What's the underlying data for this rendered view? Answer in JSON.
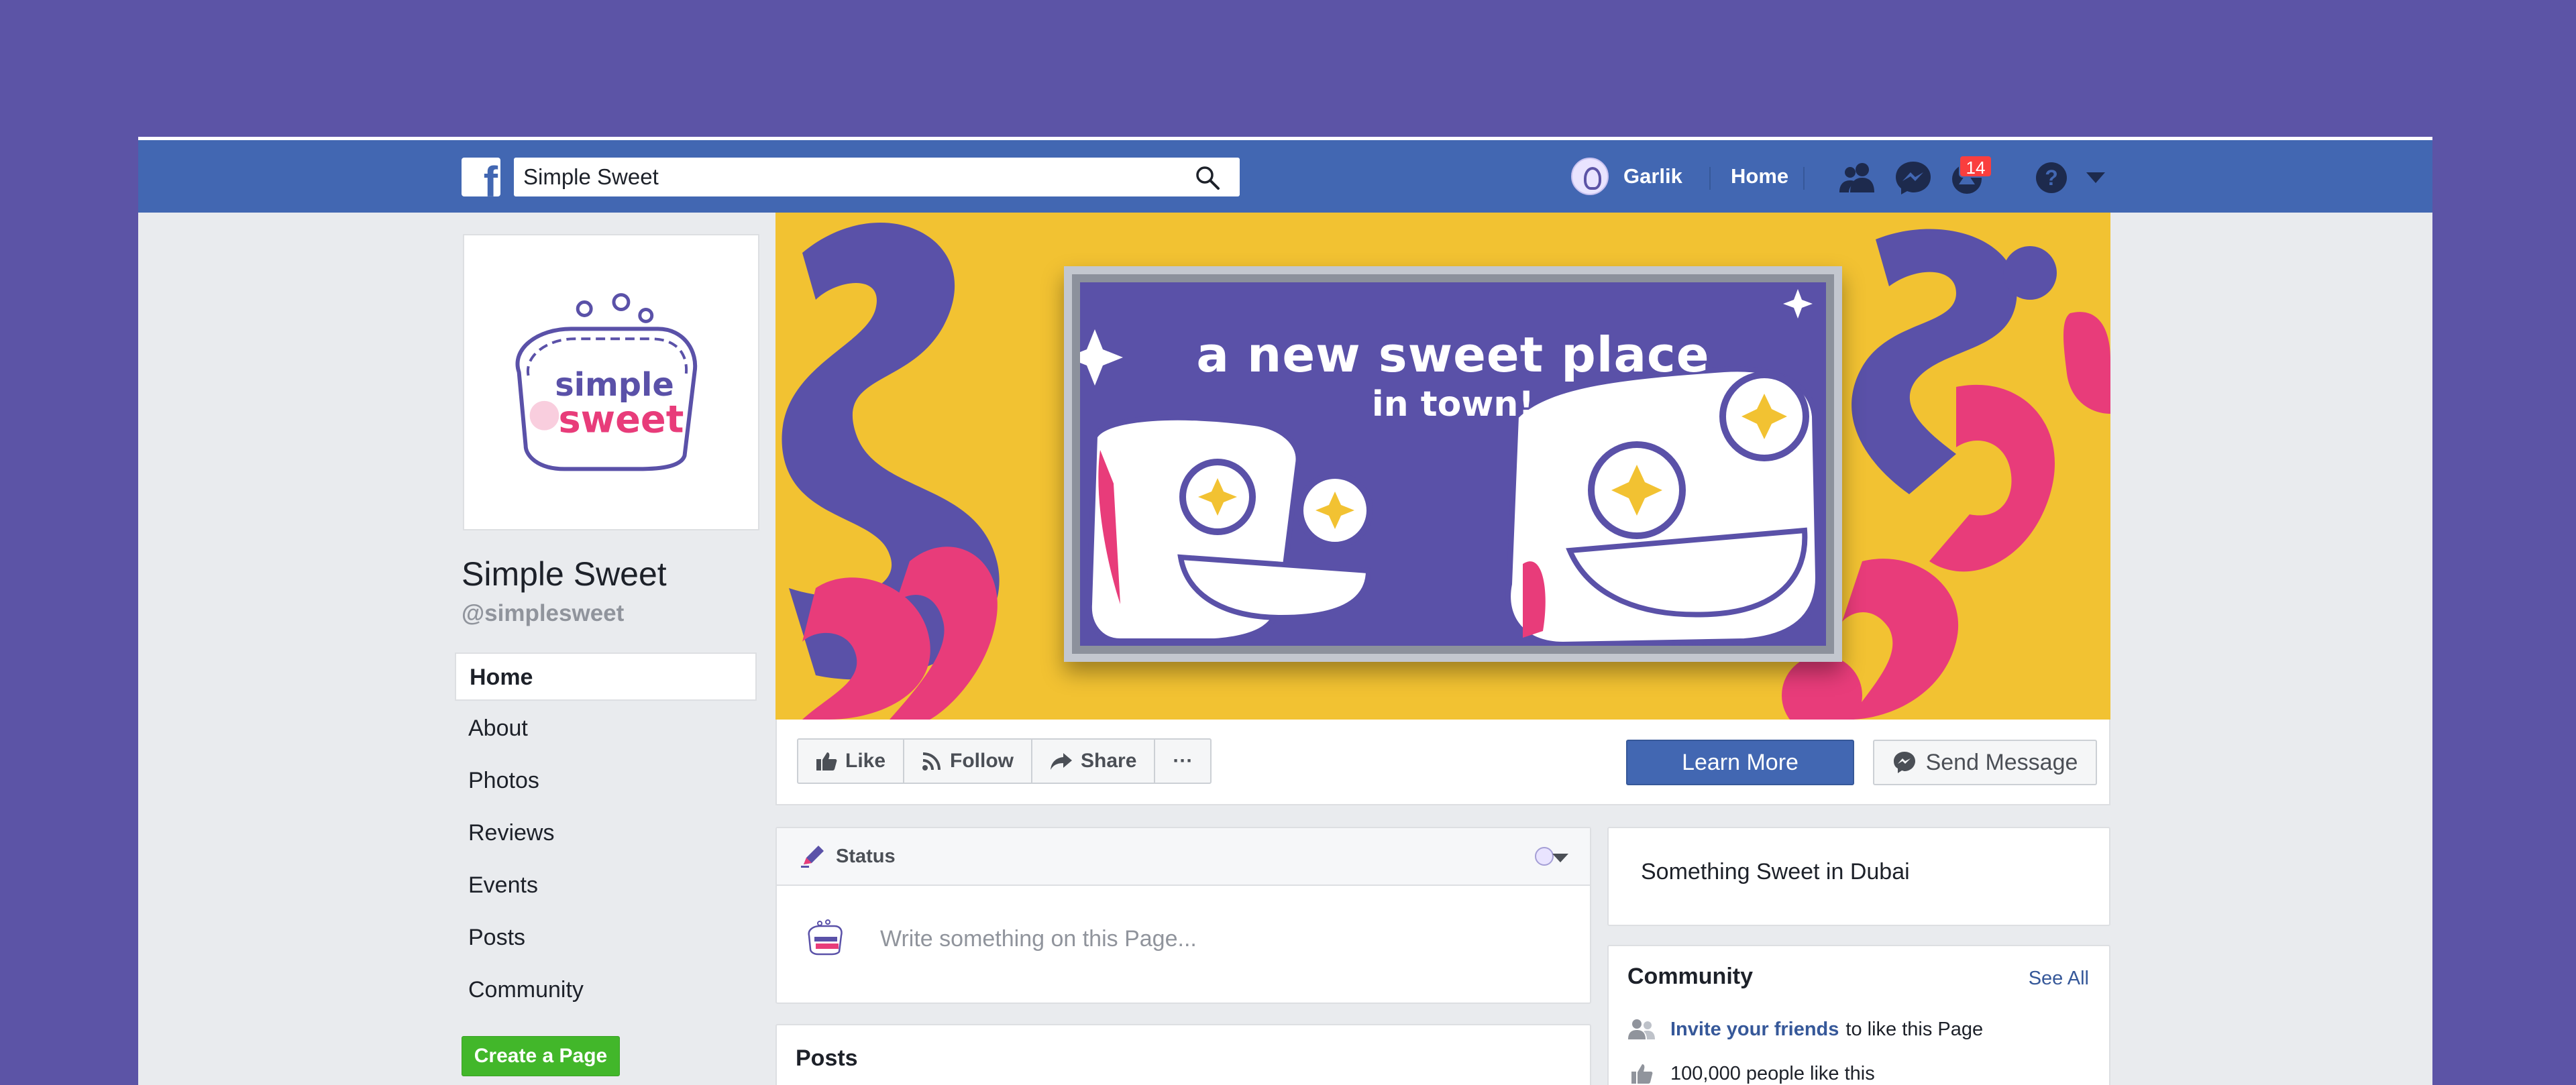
{
  "colors": {
    "background": "#5c54a6",
    "fb_blue": "#4267b2",
    "page_bg": "#e9ebee",
    "brand_purple": "#5a51a8",
    "brand_yellow": "#f2c232",
    "brand_pink": "#e83c7a",
    "create_green": "#42b72a"
  },
  "topbar": {
    "logo_icon": "facebook-f-icon",
    "search_value": "Simple Sweet",
    "search_icon": "search-icon",
    "user_name": "Garlik",
    "home_label": "Home",
    "icons": [
      "friends-icon",
      "messenger-icon",
      "notifications-icon",
      "help-icon",
      "chevron-down-icon"
    ],
    "notification_count": "14"
  },
  "page": {
    "name": "Simple Sweet",
    "handle": "@simplesweet",
    "logo_text": [
      "simple",
      "sweet"
    ]
  },
  "leftnav": {
    "items": [
      {
        "label": "Home",
        "active": true
      },
      {
        "label": "About"
      },
      {
        "label": "Photos"
      },
      {
        "label": "Reviews"
      },
      {
        "label": "Events"
      },
      {
        "label": "Posts"
      },
      {
        "label": "Community"
      }
    ],
    "create_page": "Create a Page"
  },
  "cover": {
    "line1": "a new sweet place",
    "line2": "in town!"
  },
  "actions": {
    "like": "Like",
    "follow": "Follow",
    "share": "Share",
    "more": "···",
    "learn_more": "Learn More",
    "send_message": "Send Message"
  },
  "composer": {
    "tab": "Status",
    "placeholder": "Write something on this Page..."
  },
  "posts": {
    "title": "Posts"
  },
  "about": {
    "text": "Something Sweet in Dubai"
  },
  "community": {
    "title": "Community",
    "see_all": "See All",
    "invite_link": "Invite your friends",
    "invite_rest": "to like this Page",
    "likes": "100,000 people like this"
  }
}
